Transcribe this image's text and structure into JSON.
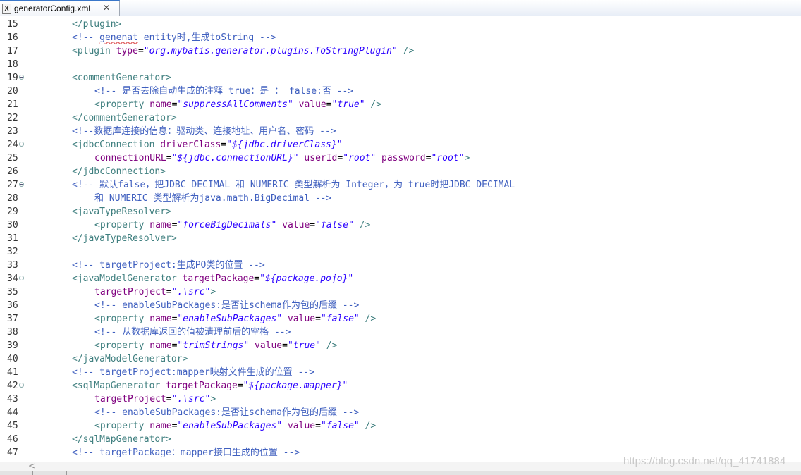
{
  "tab": {
    "filename": "generatorConfig.xml",
    "icon": "xml-file-icon",
    "close_glyph": "✕"
  },
  "lines": [
    {
      "n": "15",
      "indent": 1,
      "fold": false,
      "parts": [
        [
          "t",
          "</plugin>"
        ]
      ]
    },
    {
      "n": "16",
      "indent": 1,
      "fold": false,
      "parts": [
        [
          "c",
          "<!-- "
        ],
        [
          "cw",
          "genenat"
        ],
        [
          "c",
          " entity时,生成toString -->"
        ]
      ]
    },
    {
      "n": "17",
      "indent": 1,
      "fold": false,
      "parts": [
        [
          "t",
          "<plugin "
        ],
        [
          "a",
          "type"
        ],
        [
          "p",
          "="
        ],
        [
          "v",
          "\"org.mybatis.generator.plugins.ToStringPlugin\""
        ],
        [
          "t",
          " />"
        ]
      ]
    },
    {
      "n": "18",
      "indent": 1,
      "fold": false,
      "parts": []
    },
    {
      "n": "19",
      "indent": 1,
      "fold": true,
      "parts": [
        [
          "t",
          "<commentGenerator>"
        ]
      ]
    },
    {
      "n": "20",
      "indent": 2,
      "fold": false,
      "parts": [
        [
          "c",
          "<!-- 是否去除自动生成的注释 true：是 ： false:否 -->"
        ]
      ]
    },
    {
      "n": "21",
      "indent": 2,
      "fold": false,
      "parts": [
        [
          "t",
          "<property "
        ],
        [
          "a",
          "name"
        ],
        [
          "p",
          "="
        ],
        [
          "v",
          "\"suppressAllComments\""
        ],
        [
          "p",
          " "
        ],
        [
          "a",
          "value"
        ],
        [
          "p",
          "="
        ],
        [
          "v",
          "\"true\""
        ],
        [
          "t",
          " />"
        ]
      ]
    },
    {
      "n": "22",
      "indent": 1,
      "fold": false,
      "parts": [
        [
          "t",
          "</commentGenerator>"
        ]
      ]
    },
    {
      "n": "23",
      "indent": 1,
      "fold": false,
      "parts": [
        [
          "c",
          "<!--数据库连接的信息：驱动类、连接地址、用户名、密码 -->"
        ]
      ]
    },
    {
      "n": "24",
      "indent": 1,
      "fold": true,
      "parts": [
        [
          "t",
          "<jdbcConnection "
        ],
        [
          "a",
          "driverClass"
        ],
        [
          "p",
          "="
        ],
        [
          "v",
          "\"${jdbc.driverClass}\""
        ]
      ]
    },
    {
      "n": "25",
      "indent": 2,
      "fold": false,
      "parts": [
        [
          "a",
          "connectionURL"
        ],
        [
          "p",
          "="
        ],
        [
          "v",
          "\"${jdbc.connectionURL}\""
        ],
        [
          "p",
          " "
        ],
        [
          "a",
          "userId"
        ],
        [
          "p",
          "="
        ],
        [
          "v",
          "\"root\""
        ],
        [
          "p",
          " "
        ],
        [
          "a",
          "password"
        ],
        [
          "p",
          "="
        ],
        [
          "v",
          "\"root\""
        ],
        [
          "t",
          ">"
        ]
      ]
    },
    {
      "n": "26",
      "indent": 1,
      "fold": false,
      "parts": [
        [
          "t",
          "</jdbcConnection>"
        ]
      ]
    },
    {
      "n": "27",
      "indent": 1,
      "fold": true,
      "parts": [
        [
          "c",
          "<!-- 默认false，把JDBC DECIMAL 和 NUMERIC 类型解析为 Integer，为 true时把JDBC DECIMAL"
        ]
      ]
    },
    {
      "n": "28",
      "indent": 2,
      "fold": false,
      "parts": [
        [
          "c",
          "和 NUMERIC 类型解析为java.math.BigDecimal -->"
        ]
      ]
    },
    {
      "n": "29",
      "indent": 1,
      "fold": false,
      "parts": [
        [
          "t",
          "<javaTypeResolver>"
        ]
      ]
    },
    {
      "n": "30",
      "indent": 2,
      "fold": false,
      "parts": [
        [
          "t",
          "<property "
        ],
        [
          "a",
          "name"
        ],
        [
          "p",
          "="
        ],
        [
          "v",
          "\"forceBigDecimals\""
        ],
        [
          "p",
          " "
        ],
        [
          "a",
          "value"
        ],
        [
          "p",
          "="
        ],
        [
          "v",
          "\"false\""
        ],
        [
          "t",
          " />"
        ]
      ]
    },
    {
      "n": "31",
      "indent": 1,
      "fold": false,
      "parts": [
        [
          "t",
          "</javaTypeResolver>"
        ]
      ]
    },
    {
      "n": "32",
      "indent": 1,
      "fold": false,
      "parts": []
    },
    {
      "n": "33",
      "indent": 1,
      "fold": false,
      "parts": [
        [
          "c",
          "<!-- targetProject:生成PO类的位置 -->"
        ]
      ]
    },
    {
      "n": "34",
      "indent": 1,
      "fold": true,
      "parts": [
        [
          "t",
          "<javaModelGenerator "
        ],
        [
          "a",
          "targetPackage"
        ],
        [
          "p",
          "="
        ],
        [
          "v",
          "\"${package.pojo}\""
        ]
      ]
    },
    {
      "n": "35",
      "indent": 2,
      "fold": false,
      "parts": [
        [
          "a",
          "targetProject"
        ],
        [
          "p",
          "="
        ],
        [
          "v",
          "\".\\src\""
        ],
        [
          "t",
          ">"
        ]
      ]
    },
    {
      "n": "36",
      "indent": 2,
      "fold": false,
      "parts": [
        [
          "c",
          "<!-- enableSubPackages:是否让schema作为包的后缀 -->"
        ]
      ]
    },
    {
      "n": "37",
      "indent": 2,
      "fold": false,
      "parts": [
        [
          "t",
          "<property "
        ],
        [
          "a",
          "name"
        ],
        [
          "p",
          "="
        ],
        [
          "v",
          "\"enableSubPackages\""
        ],
        [
          "p",
          " "
        ],
        [
          "a",
          "value"
        ],
        [
          "p",
          "="
        ],
        [
          "v",
          "\"false\""
        ],
        [
          "t",
          " />"
        ]
      ]
    },
    {
      "n": "38",
      "indent": 2,
      "fold": false,
      "parts": [
        [
          "c",
          "<!-- 从数据库返回的值被清理前后的空格 -->"
        ]
      ]
    },
    {
      "n": "39",
      "indent": 2,
      "fold": false,
      "parts": [
        [
          "t",
          "<property "
        ],
        [
          "a",
          "name"
        ],
        [
          "p",
          "="
        ],
        [
          "v",
          "\"trimStrings\""
        ],
        [
          "p",
          " "
        ],
        [
          "a",
          "value"
        ],
        [
          "p",
          "="
        ],
        [
          "v",
          "\"true\""
        ],
        [
          "t",
          " />"
        ]
      ]
    },
    {
      "n": "40",
      "indent": 1,
      "fold": false,
      "parts": [
        [
          "t",
          "</javaModelGenerator>"
        ]
      ]
    },
    {
      "n": "41",
      "indent": 1,
      "fold": false,
      "parts": [
        [
          "c",
          "<!-- targetProject:mapper映射文件生成的位置 -->"
        ]
      ]
    },
    {
      "n": "42",
      "indent": 1,
      "fold": true,
      "parts": [
        [
          "t",
          "<sqlMapGenerator "
        ],
        [
          "a",
          "targetPackage"
        ],
        [
          "p",
          "="
        ],
        [
          "v",
          "\"${package.mapper}\""
        ]
      ]
    },
    {
      "n": "43",
      "indent": 2,
      "fold": false,
      "parts": [
        [
          "a",
          "targetProject"
        ],
        [
          "p",
          "="
        ],
        [
          "v",
          "\".\\src\""
        ],
        [
          "t",
          ">"
        ]
      ]
    },
    {
      "n": "44",
      "indent": 2,
      "fold": false,
      "parts": [
        [
          "c",
          "<!-- enableSubPackages:是否让schema作为包的后缀 -->"
        ]
      ]
    },
    {
      "n": "45",
      "indent": 2,
      "fold": false,
      "parts": [
        [
          "t",
          "<property "
        ],
        [
          "a",
          "name"
        ],
        [
          "p",
          "="
        ],
        [
          "v",
          "\"enableSubPackages\""
        ],
        [
          "p",
          " "
        ],
        [
          "a",
          "value"
        ],
        [
          "p",
          "="
        ],
        [
          "v",
          "\"false\""
        ],
        [
          "t",
          " />"
        ]
      ]
    },
    {
      "n": "46",
      "indent": 1,
      "fold": false,
      "parts": [
        [
          "t",
          "</sqlMapGenerator>"
        ]
      ]
    },
    {
      "n": "47",
      "indent": 1,
      "fold": false,
      "parts": [
        [
          "c",
          "<!-- targetPackage：mapper接口生成的位置 -->"
        ]
      ]
    }
  ],
  "colors": {
    "tag": "#3f7f7f",
    "attribute": "#7f007f",
    "value": "#2a00ff",
    "comment": "#3f5fbf",
    "tab_accent": "#3a77c9"
  },
  "scrollbar": {
    "left_arrow_glyph": "<"
  },
  "watermark": "https://blog.csdn.net/qq_41741884"
}
